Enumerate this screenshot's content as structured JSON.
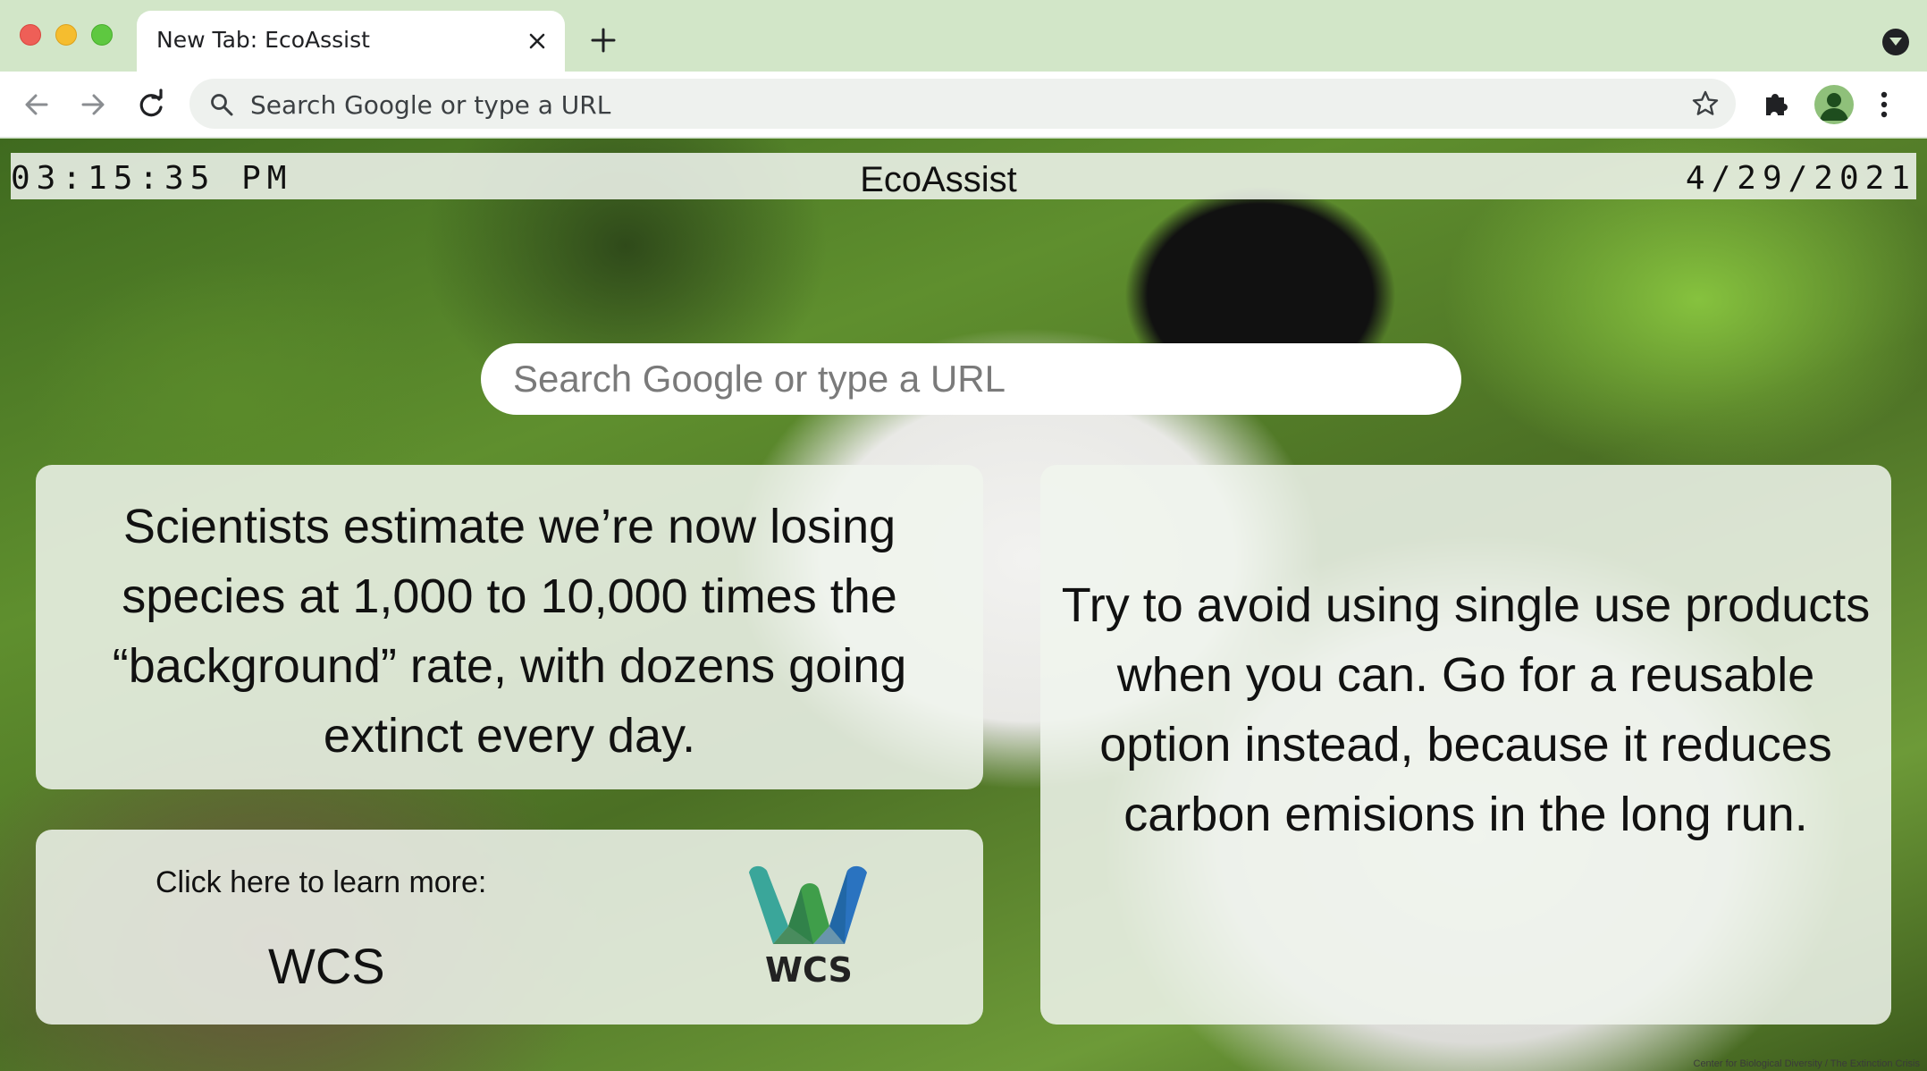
{
  "browser": {
    "tab_title": "New Tab: EcoAssist",
    "omnibox_placeholder": "Search Google or type a URL"
  },
  "page": {
    "time": "03:15:35 PM",
    "app_title": "EcoAssist",
    "date": "4/29/2021",
    "search_placeholder": "Search Google or type a URL",
    "fact": "Scientists estimate we’re now losing species at 1,000 to 10,000 times the “background” rate, with dozens going extinct every day.",
    "learn_more_label": "Click here to learn more:",
    "learn_more_link": "WCS",
    "logo_text": "WCS",
    "tip": "Try to avoid using single use products when you can. Go for a reusable option instead, because it reduces carbon emisions in the long run.",
    "photo_credit": "Center for Biological Diversity / The Extinction Crisis"
  },
  "colors": {
    "tabstrip": "#d2e6c8",
    "card_bg": "rgba(240,244,238,0.86)",
    "wcs_teal": "#3aa69a",
    "wcs_green": "#4caf50",
    "wcs_blue": "#2a73c0"
  },
  "icons": [
    "close-icon",
    "plus-icon",
    "tab-search-icon",
    "back-arrow-icon",
    "forward-arrow-icon",
    "reload-icon",
    "search-icon",
    "star-icon",
    "extensions-icon",
    "profile-icon",
    "more-vert-icon",
    "wcs-logo"
  ]
}
